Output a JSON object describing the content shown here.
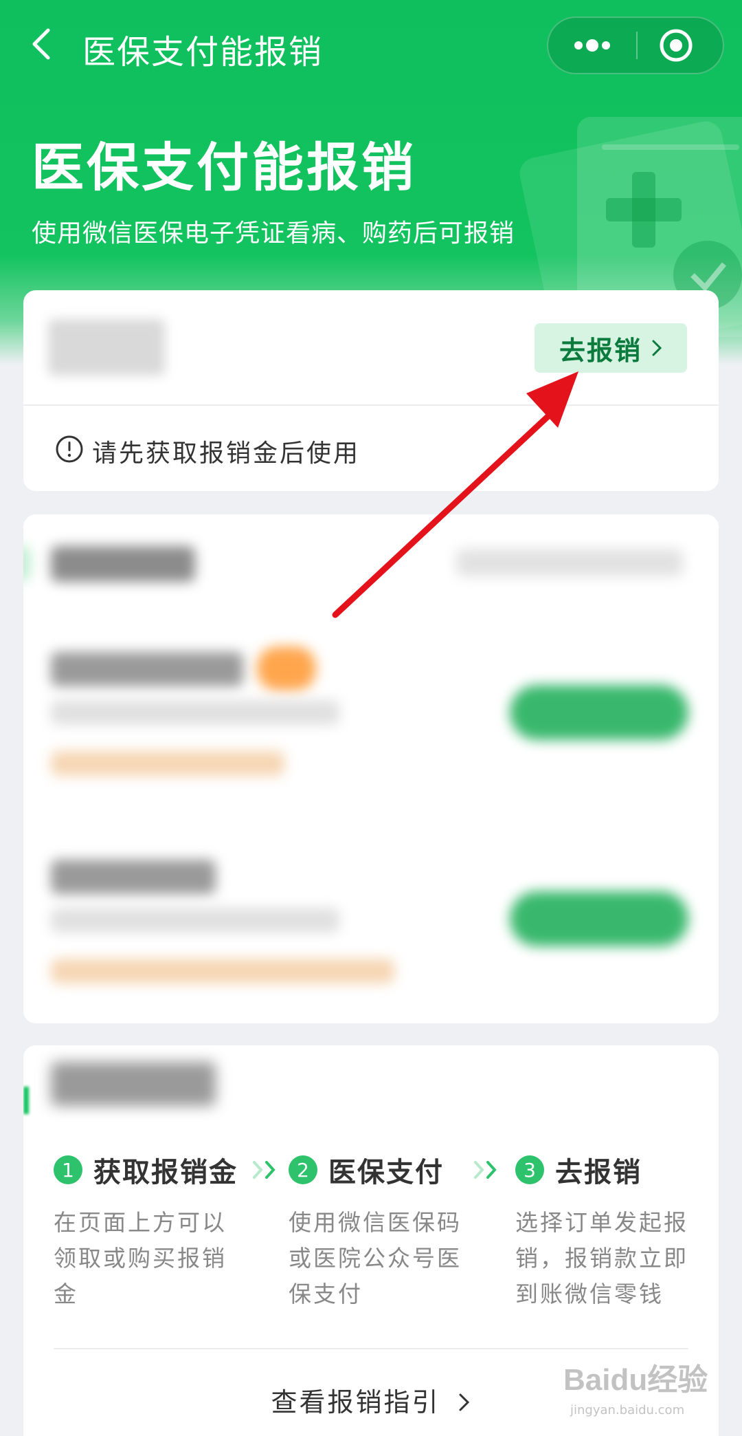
{
  "nav": {
    "title": "医保支付能报销"
  },
  "hero": {
    "title": "医保支付能报销",
    "subtitle": "使用微信医保电子凭证看病、购药后可报销"
  },
  "reimburse_card": {
    "button_label": "去报销",
    "notice": "请先获取报销金后使用"
  },
  "guide": {
    "steps": [
      {
        "num": "1",
        "title": "获取报销金",
        "desc": "在页面上方可以领取或购买报销金"
      },
      {
        "num": "2",
        "title": "医保支付",
        "desc": "使用微信医保码或医院公众号医保支付"
      },
      {
        "num": "3",
        "title": "去报销",
        "desc": "选择订单发起报销，报销款立即到账微信零钱"
      }
    ],
    "link_label": "查看报销指引"
  },
  "watermark": {
    "brand": "Baidu经验",
    "sub": "jingyan.baidu.com"
  },
  "colors": {
    "brand_green": "#13c35f",
    "button_bg": "#d7f3e2",
    "button_text": "#0a7a3d",
    "annotation_arrow": "#e3121b"
  }
}
